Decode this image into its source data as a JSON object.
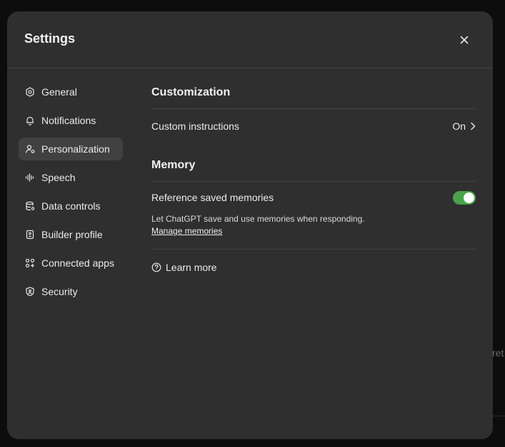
{
  "background": {
    "partial_text": "ret"
  },
  "modal": {
    "title": "Settings"
  },
  "sidebar": {
    "items": [
      {
        "label": "General",
        "icon": "gear-icon"
      },
      {
        "label": "Notifications",
        "icon": "bell-icon"
      },
      {
        "label": "Personalization",
        "icon": "person-icon",
        "active": true
      },
      {
        "label": "Speech",
        "icon": "waveform-icon"
      },
      {
        "label": "Data controls",
        "icon": "database-icon"
      },
      {
        "label": "Builder profile",
        "icon": "id-card-icon"
      },
      {
        "label": "Connected apps",
        "icon": "apps-grid-icon"
      },
      {
        "label": "Security",
        "icon": "shield-icon"
      }
    ]
  },
  "customization": {
    "title": "Customization",
    "custom_instructions_label": "Custom instructions",
    "custom_instructions_value": "On"
  },
  "memory": {
    "title": "Memory",
    "reference_label": "Reference saved memories",
    "reference_enabled": true,
    "description": "Let ChatGPT save and use memories when responding.",
    "manage_link": "Manage memories",
    "learn_more": "Learn more"
  },
  "colors": {
    "modal_bg": "#2f2f2f",
    "active_item_bg": "#414141",
    "toggle_on": "#48a34a"
  }
}
